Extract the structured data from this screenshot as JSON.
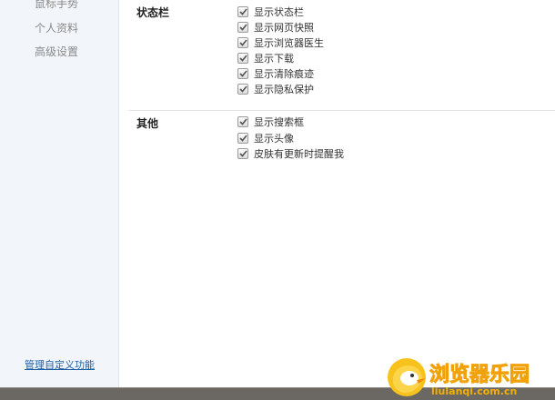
{
  "sidebar": {
    "items": [
      {
        "label": "鼠标手势"
      },
      {
        "label": "个人资料"
      },
      {
        "label": "高级设置"
      }
    ],
    "manage_link": "管理自定义功能"
  },
  "sections": [
    {
      "title": "状态栏",
      "options": [
        {
          "label": "显示状态栏",
          "checked": true
        },
        {
          "label": "显示网页快照",
          "checked": true
        },
        {
          "label": "显示浏览器医生",
          "checked": true
        },
        {
          "label": "显示下载",
          "checked": true
        },
        {
          "label": "显示清除痕迹",
          "checked": true
        },
        {
          "label": "显示隐私保护",
          "checked": true
        }
      ]
    },
    {
      "title": "其他",
      "options": [
        {
          "label": "显示搜索框",
          "checked": true
        },
        {
          "label": "显示头像",
          "checked": true
        },
        {
          "label": "皮肤有更新时提醒我",
          "checked": true
        }
      ]
    }
  ],
  "watermark": {
    "name": "浏览器乐园",
    "url": "liulanqi.com.cn"
  },
  "colors": {
    "sidebar_bg": "#f2f5fa",
    "link": "#1f5fa8",
    "watermark": "#f4b000"
  }
}
